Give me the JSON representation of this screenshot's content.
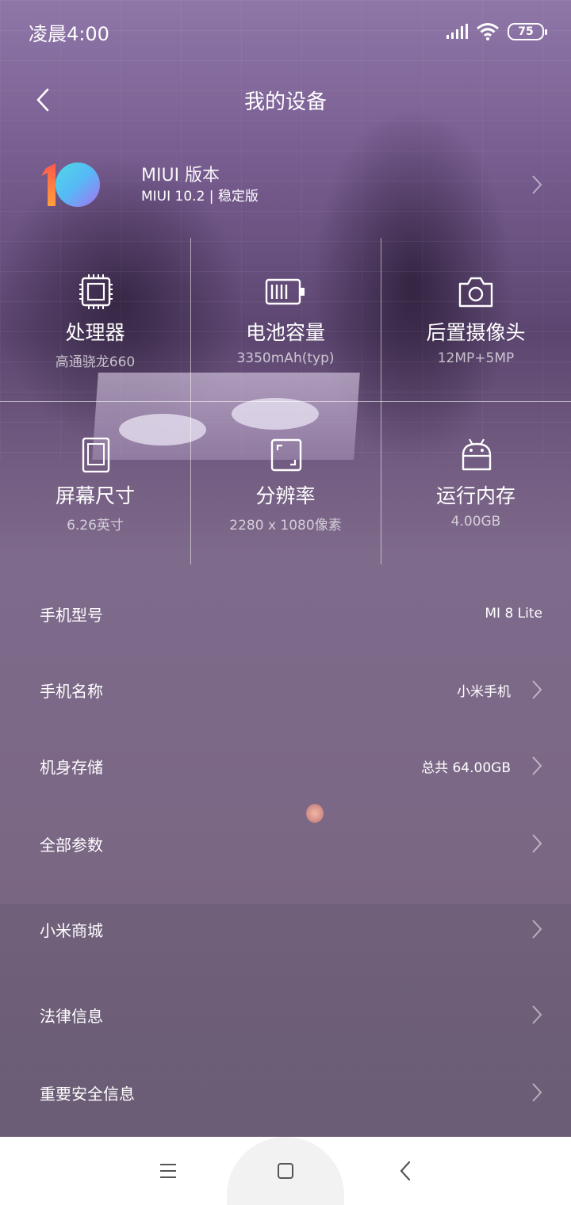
{
  "status_bar": {
    "time": "凌晨4:00",
    "battery": "75",
    "icons": [
      "signal-icon",
      "wifi-icon",
      "battery-icon"
    ]
  },
  "header": {
    "title": "我的设备",
    "back_icon": "back-chevron-icon"
  },
  "miui": {
    "label": "MIUI 版本",
    "version": "MIUI 10.2 | 稳定版"
  },
  "specs": [
    {
      "name": "处理器",
      "value": "高通骁龙660",
      "icon": "processor-chip-icon"
    },
    {
      "name": "电池容量",
      "value": "3350mAh(typ)",
      "icon": "battery-capacity-icon"
    },
    {
      "name": "后置摄像头",
      "value": "12MP+5MP",
      "icon": "camera-icon"
    },
    {
      "name": "屏幕尺寸",
      "value": "6.26英寸",
      "icon": "screen-size-icon"
    },
    {
      "name": "分辨率",
      "value": "2280 x 1080像素",
      "icon": "resolution-icon"
    },
    {
      "name": "运行内存",
      "value": "4.00GB",
      "icon": "android-icon"
    }
  ],
  "list": [
    {
      "label": "手机型号",
      "value": "MI 8 Lite",
      "arrow": false
    },
    {
      "label": "手机名称",
      "value": "小米手机",
      "arrow": true
    },
    {
      "label": "机身存储",
      "value": "总共 64.00GB",
      "arrow": true
    },
    {
      "label": "全部参数",
      "value": "",
      "arrow": true
    },
    {
      "label": "小米商城",
      "value": "",
      "arrow": true
    },
    {
      "label": "法律信息",
      "value": "",
      "arrow": true
    },
    {
      "label": "重要安全信息",
      "value": "",
      "arrow": true
    }
  ],
  "navbar": {
    "icons": [
      "menu-icon",
      "home-icon",
      "back-icon"
    ]
  }
}
